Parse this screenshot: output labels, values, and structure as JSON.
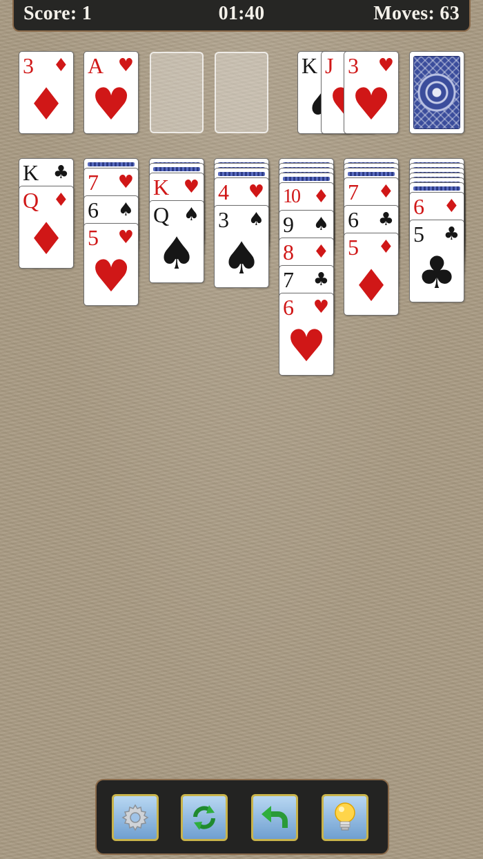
{
  "header": {
    "score_label": "Score: 1",
    "time": "01:40",
    "moves_label": "Moves: 63"
  },
  "foundations": [
    {
      "rank": "3",
      "suit": "♦",
      "color": "red"
    },
    {
      "rank": "A",
      "suit": "♥",
      "color": "red"
    },
    null,
    null
  ],
  "waste": [
    {
      "rank": "K",
      "suit": "♠",
      "color": "black"
    },
    {
      "rank": "J",
      "suit": "♥",
      "color": "red"
    },
    {
      "rank": "3",
      "suit": "♥",
      "color": "red"
    }
  ],
  "stock": {
    "has_cards": true
  },
  "tableau": [
    {
      "facedown": 0,
      "faceup": [
        {
          "rank": "K",
          "suit": "♣",
          "color": "black"
        },
        {
          "rank": "Q",
          "suit": "♦",
          "color": "red"
        }
      ]
    },
    {
      "facedown": 1,
      "faceup": [
        {
          "rank": "7",
          "suit": "♥",
          "color": "red"
        },
        {
          "rank": "6",
          "suit": "♠",
          "color": "black"
        },
        {
          "rank": "5",
          "suit": "♥",
          "color": "red"
        }
      ]
    },
    {
      "facedown": 2,
      "faceup": [
        {
          "rank": "K",
          "suit": "♥",
          "color": "red"
        },
        {
          "rank": "Q",
          "suit": "♠",
          "color": "black"
        }
      ]
    },
    {
      "facedown": 3,
      "faceup": [
        {
          "rank": "4",
          "suit": "♥",
          "color": "red"
        },
        {
          "rank": "3",
          "suit": "♠",
          "color": "black"
        }
      ]
    },
    {
      "facedown": 4,
      "faceup": [
        {
          "rank": "10",
          "suit": "♦",
          "color": "red"
        },
        {
          "rank": "9",
          "suit": "♠",
          "color": "black"
        },
        {
          "rank": "8",
          "suit": "♦",
          "color": "red"
        },
        {
          "rank": "7",
          "suit": "♣",
          "color": "black"
        },
        {
          "rank": "6",
          "suit": "♥",
          "color": "red"
        }
      ]
    },
    {
      "facedown": 3,
      "faceup": [
        {
          "rank": "7",
          "suit": "♦",
          "color": "red"
        },
        {
          "rank": "6",
          "suit": "♣",
          "color": "black"
        },
        {
          "rank": "5",
          "suit": "♦",
          "color": "red"
        }
      ]
    },
    {
      "facedown": 6,
      "faceup": [
        {
          "rank": "6",
          "suit": "♦",
          "color": "red"
        },
        {
          "rank": "5",
          "suit": "♣",
          "color": "black"
        }
      ]
    }
  ],
  "toolbar": {
    "buttons": [
      {
        "icon": "gear-icon"
      },
      {
        "icon": "refresh-icon"
      },
      {
        "icon": "undo-icon"
      },
      {
        "icon": "lightbulb-icon"
      }
    ]
  }
}
